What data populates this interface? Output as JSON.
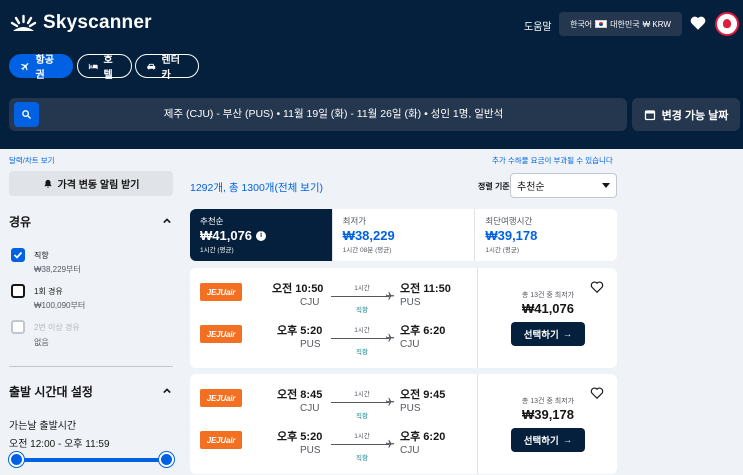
{
  "header": {
    "brand": "Skyscanner",
    "help": "도움말",
    "locale": {
      "language": "한국어",
      "country": "대한민국",
      "currency": "₩ KRW"
    },
    "icons": [
      "heart-icon",
      "avatar"
    ]
  },
  "nav": [
    {
      "label": "항공권",
      "icon": "plane-icon",
      "active": true
    },
    {
      "label": "호텔",
      "icon": "bed-icon",
      "active": false
    },
    {
      "label": "렌터카",
      "icon": "car-icon",
      "active": false
    }
  ],
  "search": {
    "summary": "제주 (CJU) - 부산 (PUS)  •  11월 19일 (화) - 11월 26일 (화)  •  성인 1명, 일반석",
    "flexible_dates": "변경 가능 날짜"
  },
  "sidebar": {
    "calendar_link": "달력/차트 보기",
    "price_alert": "가격 변동 알림 받기",
    "stops": {
      "title": "경유",
      "options": [
        {
          "label": "직항",
          "sub": "₩38,229부터",
          "checked": true,
          "disabled": false
        },
        {
          "label": "1회 경유",
          "sub": "₩100,090부터",
          "checked": false,
          "disabled": false
        },
        {
          "label": "2번 이상 경유",
          "sub": "없음",
          "checked": false,
          "disabled": true
        }
      ]
    },
    "departure_times": {
      "title": "출발 시간대 설정",
      "outbound_label": "가는날 출발시간",
      "outbound_range": "오전 12:00 - 오후 11:59",
      "range_fraction": [
        0.0,
        1.0
      ]
    }
  },
  "results": {
    "fee_notice": "추가 수하물 요금이 부과될 수 있습니다",
    "count": "1292개, 총 1300개(전체 보기)",
    "sort_label": "정렬 기준",
    "sort_value": "추천순",
    "tabs": [
      {
        "name": "추천순",
        "price": "₩41,076",
        "sub": "1시간 (평균)",
        "active": true
      },
      {
        "name": "최저가",
        "price": "₩38,229",
        "sub": "1시간 08분 (평균)",
        "active": false
      },
      {
        "name": "최단여행시간",
        "price": "₩39,178",
        "sub": "1시간 (평균)",
        "active": false
      }
    ],
    "cards": [
      {
        "legs": [
          {
            "airline": "JEJUair",
            "dep_time": "오전 10:50",
            "dep_airport": "CJU",
            "duration": "1시간",
            "type": "직항",
            "arr_time": "오전 11:50",
            "arr_airport": "PUS"
          },
          {
            "airline": "JEJUair",
            "dep_time": "오후 5:20",
            "dep_airport": "PUS",
            "duration": "1시간",
            "type": "직항",
            "arr_time": "오후 6:20",
            "arr_airport": "CJU"
          }
        ],
        "offers": "총 13건 중 최저가",
        "price": "₩41,076",
        "button": "선택하기"
      },
      {
        "legs": [
          {
            "airline": "JEJUair",
            "dep_time": "오전 8:45",
            "dep_airport": "CJU",
            "duration": "1시간",
            "type": "직항",
            "arr_time": "오전 9:45",
            "arr_airport": "PUS"
          },
          {
            "airline": "JEJUair",
            "dep_time": "오후 5:20",
            "dep_airport": "PUS",
            "duration": "1시간",
            "type": "직항",
            "arr_time": "오후 6:20",
            "arr_airport": "CJU"
          }
        ],
        "offers": "총 13건 중 최저가",
        "price": "₩39,178",
        "button": "선택하기"
      }
    ]
  },
  "colors": {
    "header_bg": "#05203c",
    "accent": "#0062e3",
    "airline": "#f36f21",
    "page_bg": "#eff3f8"
  }
}
